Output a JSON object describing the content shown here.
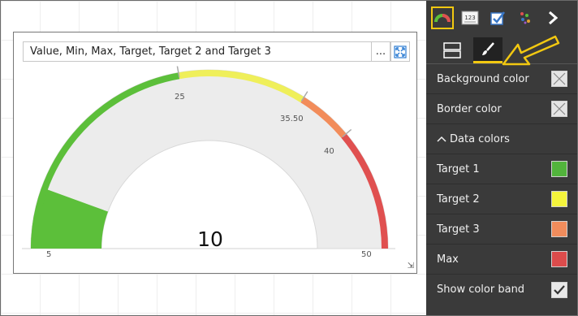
{
  "visual": {
    "title": "Value, Min, Max, Target, Target 2 and Target 3",
    "more_label": "...",
    "value_display": "10",
    "gauge": {
      "min": 5,
      "max": 50,
      "value": 10,
      "target1": 25,
      "target2": 35.5,
      "target3": 40,
      "band_colors": [
        "#5cbf3a",
        "#efef5a",
        "#f28c5a",
        "#e05050"
      ]
    },
    "tick_labels": {
      "min": "5",
      "t1": "25",
      "t2": "35.50",
      "t3": "40",
      "max": "50"
    }
  },
  "panel": {
    "rows": {
      "background_color": "Background color",
      "border_color": "Border color",
      "data_colors": "Data colors",
      "target1": "Target 1",
      "target2": "Target 2",
      "target3": "Target 3",
      "max": "Max",
      "show_color_band": "Show color band"
    },
    "colors": {
      "target1": "#52b43c",
      "target2": "#f4f43c",
      "target3": "#f08c5c",
      "max": "#dc4c4c"
    },
    "chevron_symbol": "^",
    "viz_icons": [
      "gauge-icon",
      "card-number-icon",
      "checkbox-visual-icon",
      "scatter-icon",
      "chevron-right-icon"
    ],
    "accent": "#f2c811"
  }
}
